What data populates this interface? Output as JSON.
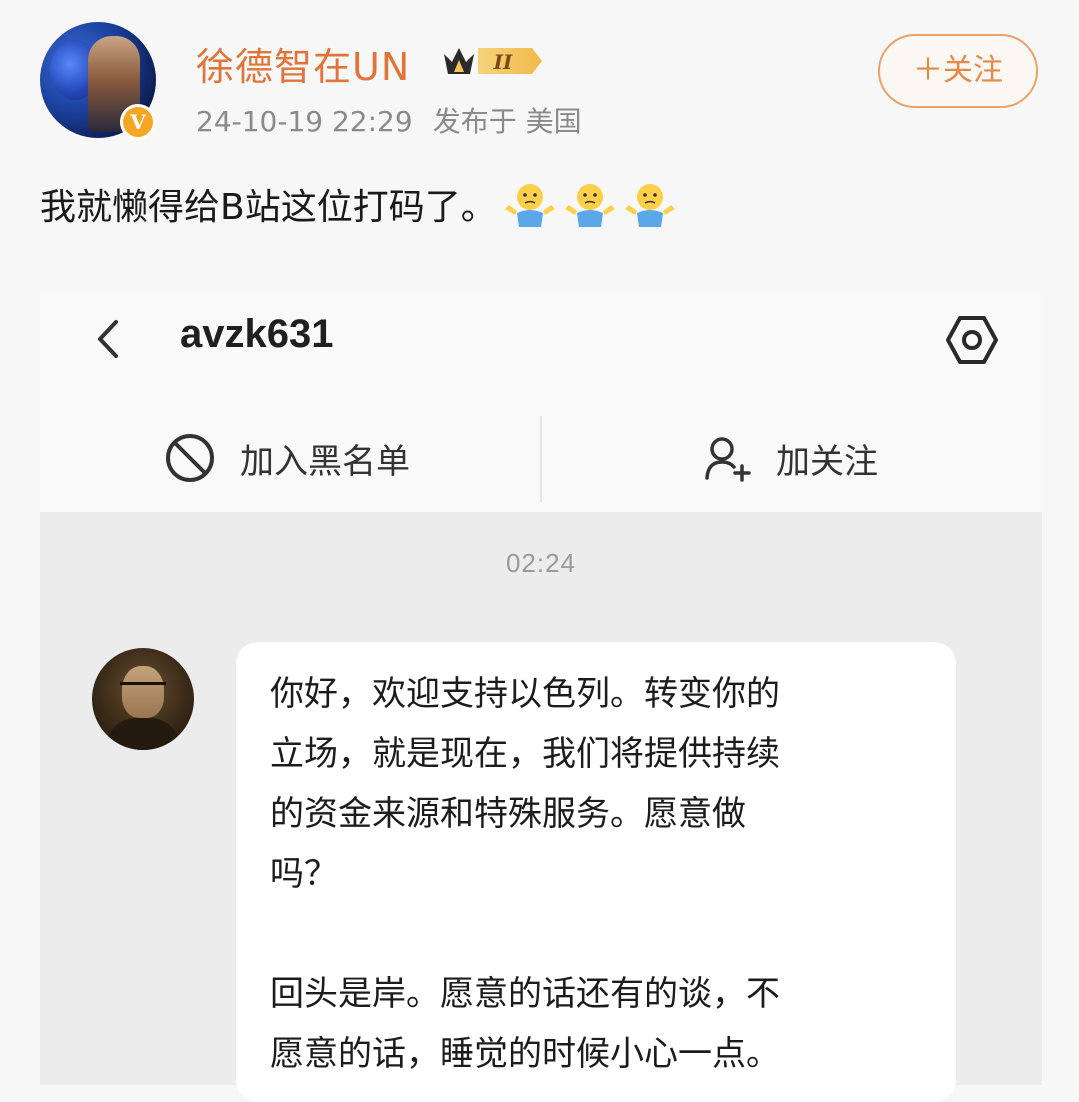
{
  "post": {
    "username": "徐德智在UN",
    "level_badge_text": "II",
    "timestamp": "24-10-19 22:29",
    "location": "发布于 美国",
    "follow_label": "＋关注",
    "verified_glyph": "V",
    "text": "我就懒得给B站这位打码了。",
    "emoji_count": 3,
    "emoji": "shrug-emoji",
    "colors": {
      "username": "#e0743a",
      "follow_border": "#e9a26b",
      "verified": "#f5a623"
    }
  },
  "dm": {
    "title": "avzk631",
    "actions": {
      "block_label": "加入黑名单",
      "follow_label": "加关注"
    },
    "time": "02:24",
    "message_para1": "你好，欢迎支持以色列。转变你的\n立场，就是现在，我们将提供持续\n的资金来源和特殊服务。愿意做\n吗？",
    "message_para2": "回头是岸。愿意的话还有的谈，不\n愿意的话，睡觉的时候小心一点。"
  }
}
